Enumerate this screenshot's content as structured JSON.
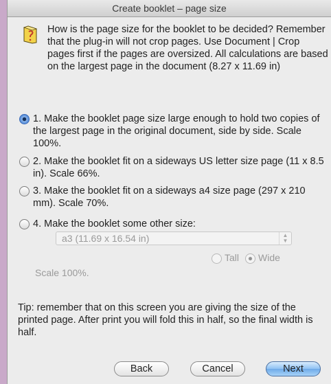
{
  "window": {
    "title": "Create booklet – page size"
  },
  "intro": "How is the page size for the booklet to be decided? Remember that the plug-in will not crop pages. Use Document | Crop pages first if the pages are oversized. All calculations are based on the largest page in the document (8.27 x 11.69 in)",
  "options": [
    {
      "label": "1. Make the booklet page size large enough to hold two copies of the largest page in the original document, side by side.  Scale 100%.",
      "selected": true
    },
    {
      "label": "2. Make the booklet fit on a sideways US letter size page (11 x 8.5 in). Scale 66%.",
      "selected": false
    },
    {
      "label": "3. Make the booklet fit on a sideways a4 size page (297 x 210 mm). Scale 70%.",
      "selected": false
    },
    {
      "label": "4. Make the booklet some other size:",
      "selected": false
    }
  ],
  "size_select": {
    "value": "a3 (11.69 x 16.54 in)"
  },
  "orientation": {
    "tall_label": "Tall",
    "wide_label": "Wide",
    "selected": "Wide"
  },
  "scale_text": "Scale 100%.",
  "tip": "Tip: remember that on this screen you are giving the size of the printed page. After print you will fold this in half, so the final width is half.",
  "buttons": {
    "back": "Back",
    "cancel": "Cancel",
    "next": "Next"
  },
  "icons": {
    "document": "document-icon",
    "select_arrows": "select-arrows-icon"
  }
}
